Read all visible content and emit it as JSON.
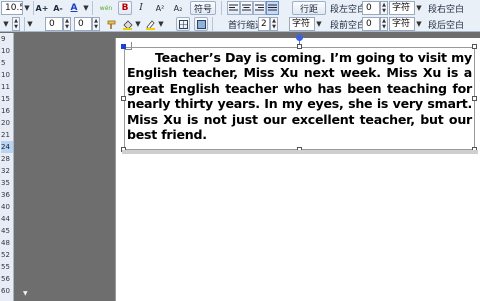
{
  "toolbar": {
    "row1": {
      "font_size": "10.5",
      "grow_font": "A+",
      "shrink_font": "A-",
      "font_color": "A",
      "phonetic": "wén",
      "bold": "B",
      "italic": "I",
      "superscript": "A²",
      "subscript": "A₂",
      "symbol_button": "符号",
      "line_spacing_button": "行距",
      "space_before_label": "段左空白",
      "space_before_value": "0",
      "unit_char_1": "字符",
      "space_right_label": "段右空白"
    },
    "row2": {
      "value_a": "0",
      "value_b": "0",
      "first_indent_label": "首行缩进",
      "first_indent_value": "2",
      "unit_char_2": "字符",
      "space_before_para_label": "段前空白",
      "space_before_para_value": "0",
      "unit_char_3": "字符",
      "space_after_label": "段后空白"
    }
  },
  "ruler": {
    "numbers": [
      "9",
      "10",
      "5",
      "10",
      "11",
      "15",
      "16",
      "20",
      "21",
      "24",
      "28",
      "32",
      "35",
      "36",
      "40",
      "44",
      "45",
      "48",
      "52",
      "55",
      "56",
      "60"
    ],
    "highlighted": "24"
  },
  "document": {
    "paragraph": "Teacher’s Day is coming. I’m going to visit my English teacher, Miss Xu next week. Miss Xu is a great English teacher who has been teaching for nearly thirty years. In my eyes, she is very smart. Miss Xu is not just our excellent teacher, but our best friend."
  },
  "colors": {
    "toolbar_bg": "#eaf0f8",
    "workspace_bg": "#6e6e6e",
    "page_bg": "#ffffff",
    "selection_blue": "#1c3fd8"
  }
}
